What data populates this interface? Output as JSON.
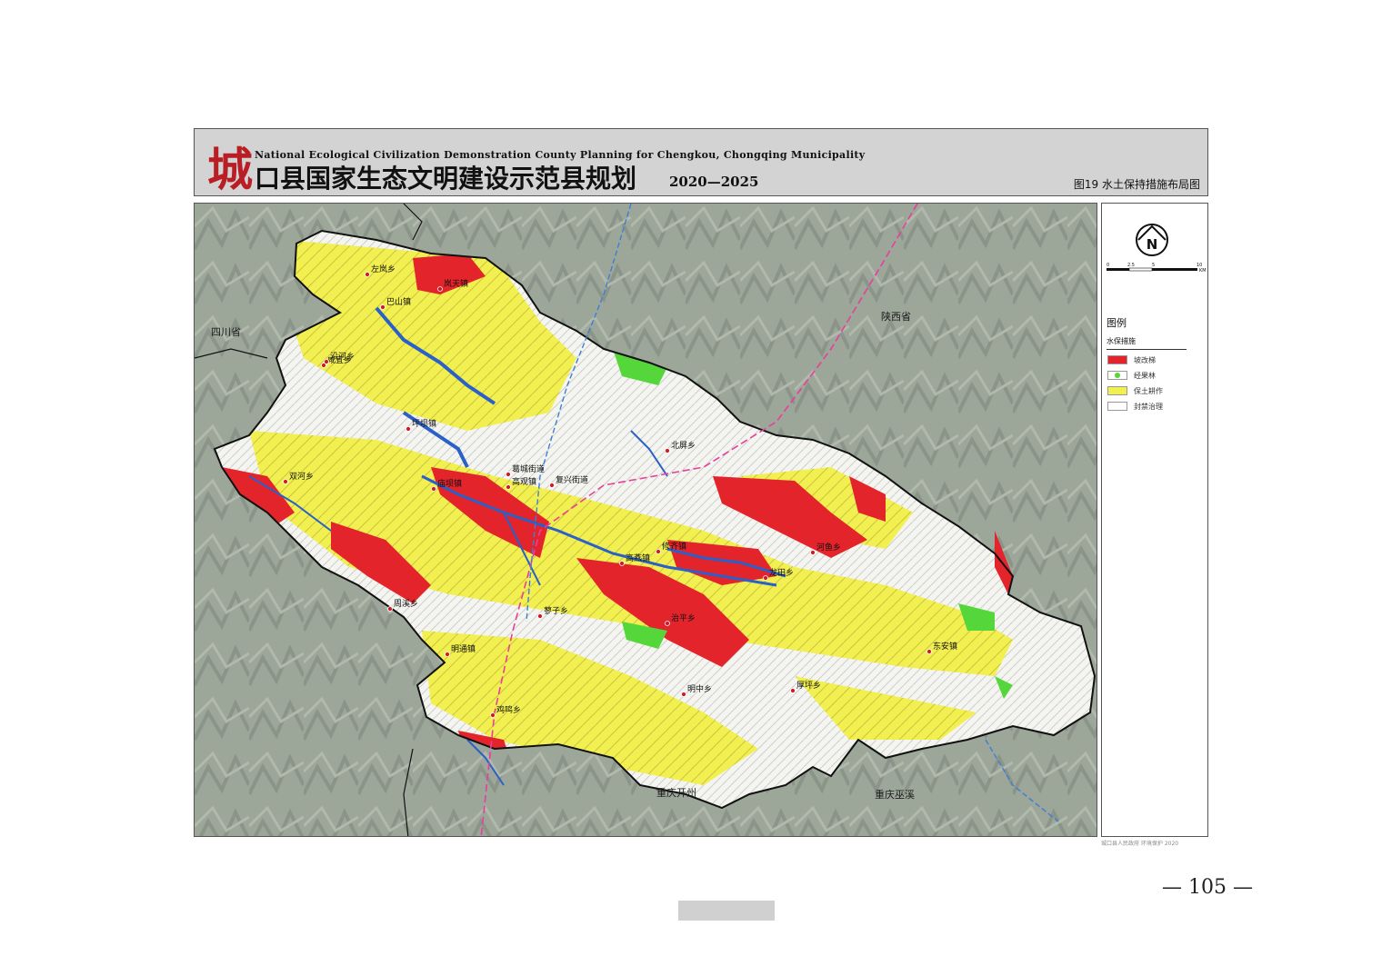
{
  "banner": {
    "logo_char": "城",
    "title_en": "National Ecological Civilization Demonstration County Planning for Chengkou, Chongqing Municipality",
    "title_cn": "口县国家生态文明建设示范县规划",
    "years": "2020—2025",
    "figure_caption": "图19  水土保持措施布局图"
  },
  "map": {
    "regions": {
      "sichuan": "四川省",
      "shaanxi": "陕西省",
      "kaizhou": "重庆开州",
      "wuxi": "重庆巫溪"
    },
    "places": [
      "左岚乡",
      "岚天镇",
      "巴山镇",
      "咸宜乡",
      "坪坝镇",
      "沿河乡",
      "北屏乡",
      "葛城街道",
      "复兴街道",
      "高观镇",
      "庙坝镇",
      "双河乡",
      "修齐镇",
      "河鱼乡",
      "龙田乡",
      "厚坪乡",
      "明中乡",
      "东安镇",
      "蓼子乡",
      "周溪乡",
      "明通镇",
      "鸡鸣乡",
      "治平乡",
      "高燕镇"
    ],
    "colors": {
      "erosion_control": "#e3242b",
      "economic_forest": "#55d63a",
      "soil_tillage": "#f2f050",
      "closure": "#ffffff",
      "water": "#2a60c8",
      "boundary": "#111111",
      "road_pink": "#e83e9c",
      "road_blue": "#3e7fd6"
    }
  },
  "legend": {
    "north_letter": "N",
    "scale_labels": [
      "0",
      "2.5",
      "5",
      "10"
    ],
    "scale_unit": "KM",
    "heading": "图例",
    "subheading": "水保措施",
    "items": [
      {
        "label": "坡改梯",
        "color": "#e3242b",
        "dot": false
      },
      {
        "label": "经果林",
        "color": "#ffffff",
        "dot": true
      },
      {
        "label": "保土耕作",
        "color": "#f2f050",
        "dot": false
      },
      {
        "label": "封禁治理",
        "color": "#ffffff",
        "dot": false
      }
    ],
    "credit": "城口县人民政府 环境保护 2020"
  },
  "page": {
    "number": "— 105 —"
  }
}
